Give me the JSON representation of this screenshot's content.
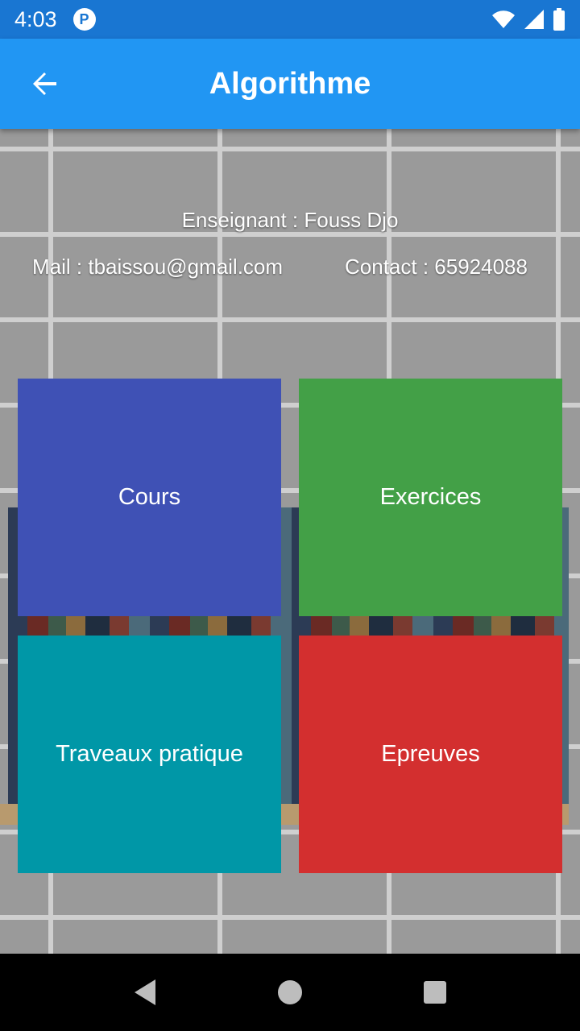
{
  "status_bar": {
    "time": "4:03",
    "icons": [
      "app-notification-icon",
      "wifi-icon",
      "signal-icon",
      "battery-icon"
    ]
  },
  "app_bar": {
    "title": "Algorithme",
    "back_icon": "arrow-back-icon"
  },
  "info": {
    "teacher": "Enseignant : Fouss Djo",
    "mail": "Mail : tbaissou@gmail.com",
    "contact": "Contact : 65924088"
  },
  "tiles": [
    {
      "label": "Cours",
      "color": "#3f51b5"
    },
    {
      "label": "Exercices",
      "color": "#43a047"
    },
    {
      "label": "Traveaux pratique",
      "color": "#0097a7"
    },
    {
      "label": "Epreuves",
      "color": "#d32f2f"
    }
  ],
  "nav_bar": {
    "icons": [
      "back-triangle-icon",
      "home-circle-icon",
      "recents-square-icon"
    ]
  },
  "colors": {
    "status_bar": "#1976d2",
    "app_bar": "#2196f3"
  }
}
